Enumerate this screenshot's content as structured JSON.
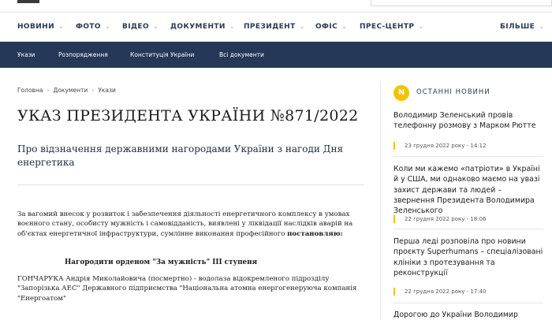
{
  "nav": {
    "items": [
      {
        "label": "НОВИНИ",
        "chevron": true
      },
      {
        "label": "ФОТО",
        "chevron": true
      },
      {
        "label": "ВІДЕО",
        "chevron": true
      },
      {
        "label": "ДОКУМЕНТИ",
        "chevron": true
      },
      {
        "label": "ПРЕЗИДЕНТ",
        "chevron": true
      },
      {
        "label": "ОФІС",
        "chevron": true
      },
      {
        "label": "ПРЕС-ЦЕНТР",
        "chevron": true
      },
      {
        "label": "БІЛЬШЕ",
        "chevron": true
      }
    ],
    "chevron_glyph": "⌄"
  },
  "subnav": {
    "items": [
      "Укази",
      "Розпорядження",
      "Конституція України",
      "Всі документи"
    ],
    "background": "#253858"
  },
  "breadcrumb": {
    "items": [
      "Головна",
      "Документи",
      "Укази"
    ],
    "separator": "›"
  },
  "article": {
    "title": "УКАЗ ПРЕЗИДЕНТА УКРАЇНИ №871/2022",
    "subtitle": "Про відзначення державними нагородами України з нагоди Дня енергетика",
    "body_intro": "За вагомий внесок у розвиток і забезпечення діяльності енергетичного комплексу в умовах воєнного стану, особисту мужність і самовідданість, виявлені у ліквідації наслідків аварій на об'єктах енергетичної інфраструктури, сумлінне виконання професійного",
    "body_bold": "постановляю:",
    "award_heading": "Нагородити орденом \"За мужність\" III ступеня",
    "award_person": "ГОНЧАРУКА Андрія Миколайовича (посмертно) - водолаза відокремленого підрозділу \"Запорізька АЕС\" Державного підприємства \"Національна атомна енергогенеруюча компанія \"Енергоатом\""
  },
  "sidebar": {
    "badge_letter": "N",
    "heading": "ОСТАННІ НОВИНИ",
    "accent": "#f2c300",
    "news": [
      {
        "title": "Володимир Зеленський провів телефонну розмову з Марком Рютте",
        "date": "23 грудня 2022 року - 14:12"
      },
      {
        "title": "Коли ми кажемо «патріоти» в Україні й у США, ми однаково маємо на увазі захист держави та людей – звернення Президента Володимира Зеленського",
        "date": "22 грудня 2022 року - 18:06"
      },
      {
        "title": "Перша леді розповіла про новини проєкту Superhumans – спеціалізовані клініки з протезування та реконструкції",
        "date": "22 грудня 2022 року - 17:40"
      },
      {
        "title": "Дорогою до України Володимир",
        "date": ""
      }
    ]
  }
}
